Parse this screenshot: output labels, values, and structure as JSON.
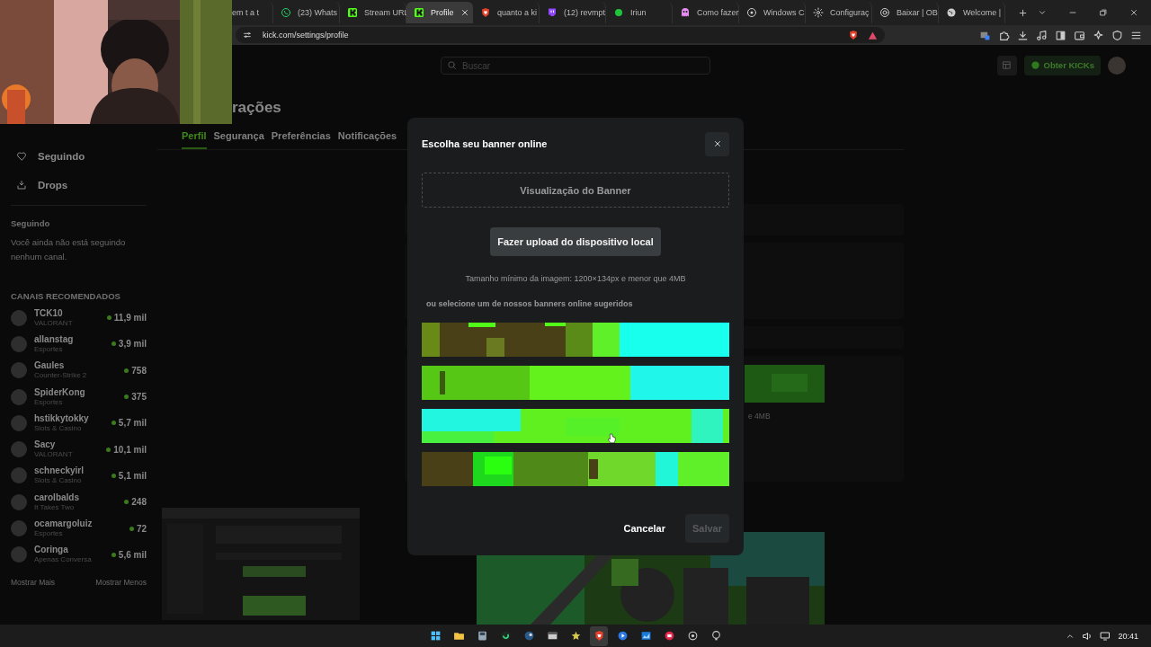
{
  "browser": {
    "tabs": [
      {
        "title": "em t a t",
        "selected": false
      },
      {
        "title": "(23) Whats",
        "selected": false
      },
      {
        "title": "Stream URL",
        "selected": false
      },
      {
        "title": "Profile",
        "selected": true
      },
      {
        "title": "quanto a ki",
        "selected": false
      },
      {
        "title": "(12) revmpt",
        "selected": false
      },
      {
        "title": "Iriun",
        "selected": false
      },
      {
        "title": "Como fazer",
        "selected": false
      },
      {
        "title": "Windows C",
        "selected": false
      },
      {
        "title": "Configuraç",
        "selected": false
      },
      {
        "title": "Baixar | OB",
        "selected": false
      },
      {
        "title": "Welcome |",
        "selected": false
      }
    ],
    "url": "kick.com/settings/profile"
  },
  "header": {
    "search_placeholder": "Buscar",
    "kicks_button": "Obter KICKs"
  },
  "sidebar": {
    "nav": [
      "Seguindo",
      "Drops"
    ],
    "following_title": "Seguindo",
    "following_empty": "Você ainda não está seguindo nenhum canal.",
    "recommended_title": "CANAIS RECOMENDADOS",
    "channels": [
      {
        "name": "TCK10",
        "category": "VALORANT",
        "viewers": "11,9 mil"
      },
      {
        "name": "allanstag",
        "category": "Esportes",
        "viewers": "3,9 mil"
      },
      {
        "name": "Gaules",
        "category": "Counter-Strike 2",
        "viewers": "758"
      },
      {
        "name": "SpiderKong",
        "category": "Esportes",
        "viewers": "375"
      },
      {
        "name": "hstikkytokky",
        "category": "Slots & Casino",
        "viewers": "5,7 mil"
      },
      {
        "name": "Sacy",
        "category": "VALORANT",
        "viewers": "10,1 mil"
      },
      {
        "name": "schneckyirl",
        "category": "Slots & Casino",
        "viewers": "5,1 mil"
      },
      {
        "name": "carolbalds",
        "category": "It Takes Two",
        "viewers": "248"
      },
      {
        "name": "ocamargoluiz",
        "category": "Esportes",
        "viewers": "72"
      },
      {
        "name": "Coringa",
        "category": "Apenas Conversa",
        "viewers": "5,6 mil"
      }
    ],
    "show_more": "Mostrar Mais",
    "show_less": "Mostrar Menos"
  },
  "settings": {
    "title": "rações",
    "tabs": [
      {
        "label": "Perfil",
        "selected": true
      },
      {
        "label": "Segurança",
        "selected": false
      },
      {
        "label": "Preferências",
        "selected": false
      },
      {
        "label": "Notificações",
        "selected": false
      }
    ],
    "hint_fragment": "e 4MB"
  },
  "modal": {
    "title": "Escolha seu banner online",
    "preview_label": "Visualização do Banner",
    "upload_button": "Fazer upload do dispositivo local",
    "size_hint": "Tamanho mínimo da imagem: 1200×134px e menor que 4MB",
    "suggest_label": "ou selecione um de nossos banners online sugeridos",
    "cancel_button": "Cancelar",
    "save_button": {
      "label": "Salvar",
      "disabled": true
    }
  },
  "taskbar": {
    "apps": [
      {
        "selected": false
      },
      {
        "selected": false
      },
      {
        "selected": false
      },
      {
        "selected": false
      },
      {
        "selected": false
      },
      {
        "selected": false
      },
      {
        "selected": false
      },
      {
        "selected": true
      },
      {
        "selected": false
      },
      {
        "selected": false
      },
      {
        "selected": false
      },
      {
        "selected": false
      },
      {
        "selected": false
      }
    ],
    "time": "20:41"
  }
}
